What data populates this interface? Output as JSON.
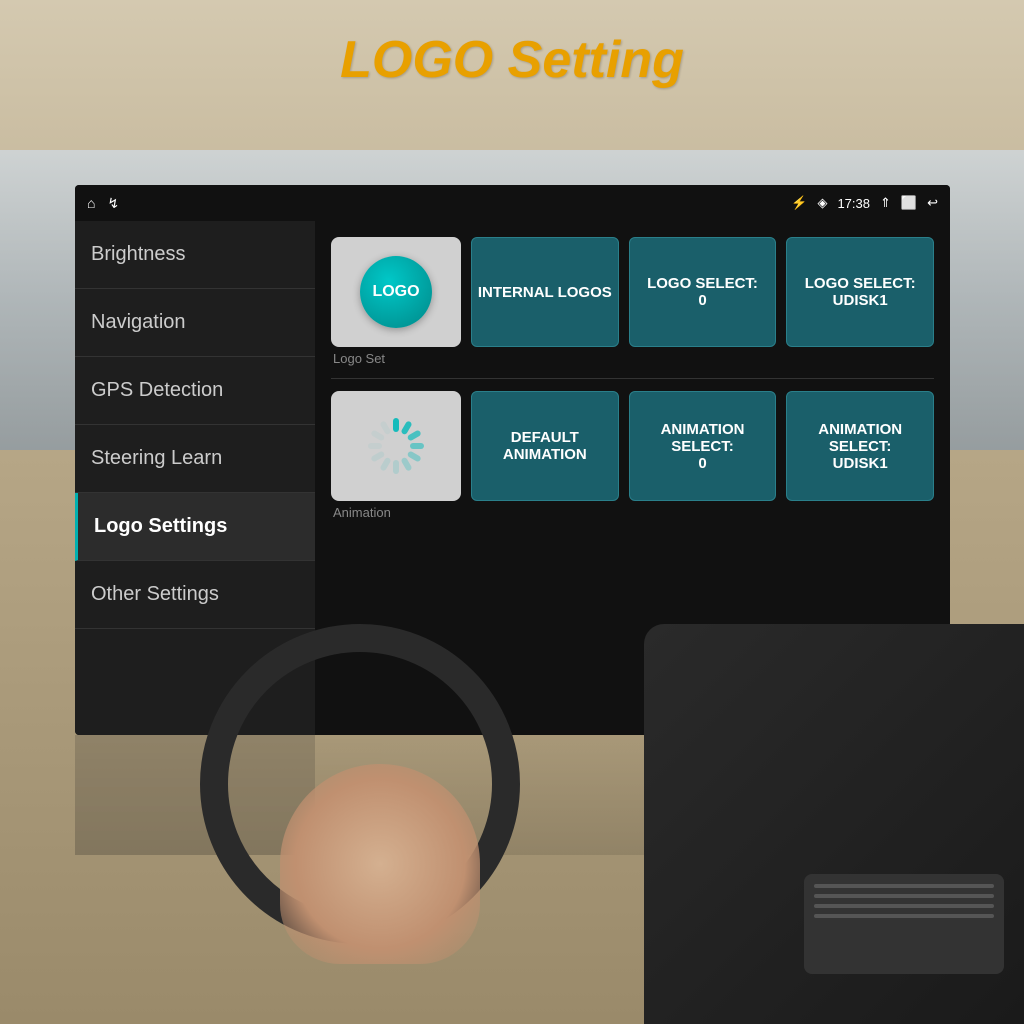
{
  "page": {
    "title": "LOGO Setting"
  },
  "statusBar": {
    "time": "17:38",
    "homeIcon": "⌂",
    "usbIcon": "↯",
    "bluetoothIcon": "⚡",
    "signalIcon": "◈",
    "updownIcon": "⇑",
    "windowIcon": "⬜",
    "backIcon": "↩"
  },
  "sidebar": {
    "items": [
      {
        "id": "brightness",
        "label": "Brightness",
        "active": false
      },
      {
        "id": "navigation",
        "label": "Navigation",
        "active": false
      },
      {
        "id": "gps-detection",
        "label": "GPS Detection",
        "active": false
      },
      {
        "id": "steering-learn",
        "label": "Steering Learn",
        "active": false
      },
      {
        "id": "logo-settings",
        "label": "Logo Settings",
        "active": true
      },
      {
        "id": "other-settings",
        "label": "Other Settings",
        "active": false
      }
    ]
  },
  "logoSection": {
    "tileLabel": "Logo Set",
    "buttons": [
      {
        "id": "internal-logos",
        "label": "INTERNAL LOGOS"
      },
      {
        "id": "logo-select-0",
        "label": "LOGO SELECT:\n0"
      },
      {
        "id": "logo-select-udisk1",
        "label": "LOGO SELECT:\nUDISK1"
      }
    ]
  },
  "animationSection": {
    "tileLabel": "Animation",
    "buttons": [
      {
        "id": "default-animation",
        "label": "DEFAULT\nANIMATION"
      },
      {
        "id": "animation-select-0",
        "label": "ANIMATION\nSELECT:\n0"
      },
      {
        "id": "animation-select-udisk1",
        "label": "ANIMATION\nSELECT:\nUDISK1"
      }
    ]
  }
}
